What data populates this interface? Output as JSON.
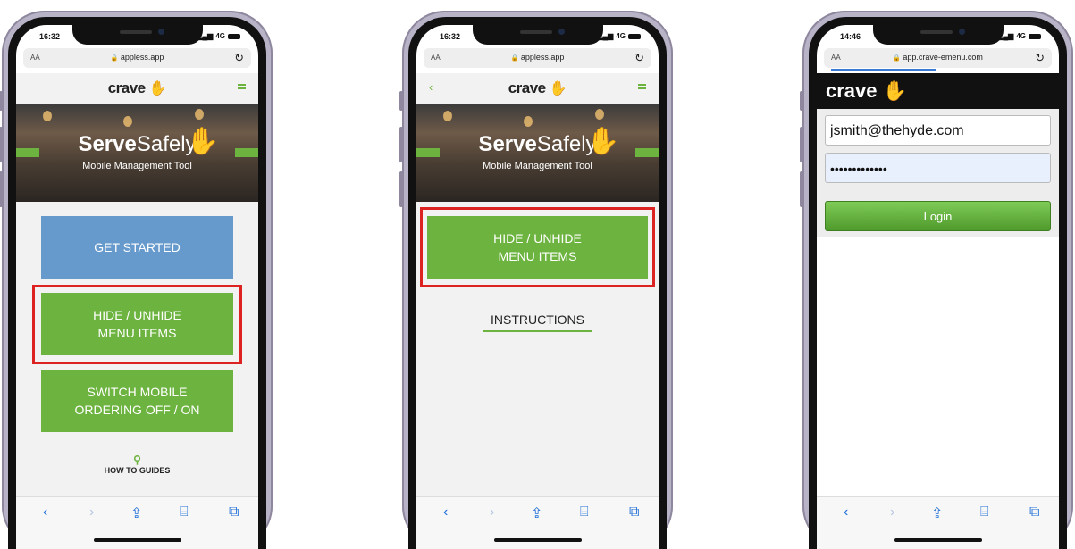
{
  "phones": [
    {
      "time": "16:32",
      "signal": "4G",
      "url": "appless.app",
      "text_size": "AA",
      "banner_brand_bold": "Serve",
      "banner_brand_rest": "Safely",
      "banner_sub": "Mobile Management Tool",
      "buttons": {
        "get_started": "GET STARTED",
        "hide_l1": "HIDE / UNHIDE",
        "hide_l2": "MENU ITEMS",
        "switch_l1": "SWITCH MOBILE",
        "switch_l2": "ORDERING OFF / ON"
      },
      "how_to_guides": "HOW TO GUIDES"
    },
    {
      "time": "16:32",
      "signal": "4G",
      "url": "appless.app",
      "text_size": "AA",
      "banner_brand_bold": "Serve",
      "banner_brand_rest": "Safely",
      "banner_sub": "Mobile Management Tool",
      "buttons": {
        "hide_l1": "HIDE / UNHIDE",
        "hide_l2": "MENU ITEMS"
      },
      "instructions": "INSTRUCTIONS"
    },
    {
      "time": "14:46",
      "signal": "4G",
      "url": "app.crave-emenu.com",
      "text_size": "AA",
      "email": "jsmith@thehyde.com",
      "password_mask": "•••••••••••••",
      "login_label": "Login"
    }
  ],
  "logo_text": "crave",
  "colors": {
    "green": "#6db33f",
    "blue": "#6699cc",
    "highlight": "#dd2222",
    "frame": "#b9b3c7"
  },
  "icons": {
    "back": "chevron-left-icon",
    "forward": "chevron-right-icon",
    "share": "share-icon",
    "bookmarks": "book-icon",
    "tabs": "tabs-icon",
    "lock": "lock-icon",
    "reload": "reload-icon",
    "search": "search-icon"
  }
}
